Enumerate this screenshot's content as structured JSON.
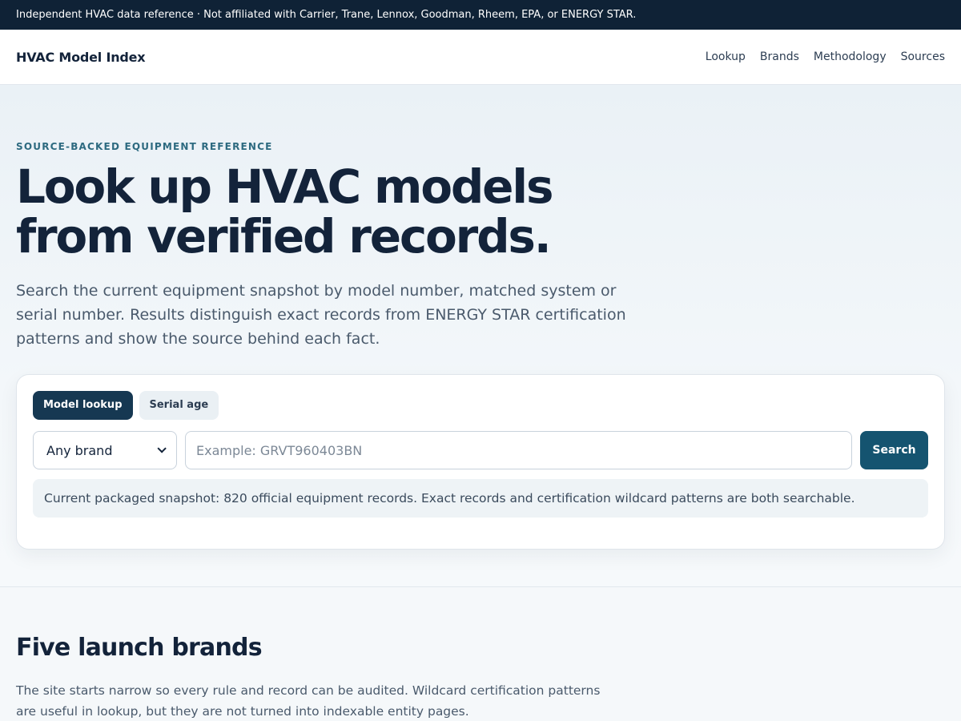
{
  "topbar": {
    "notice": "Independent HVAC data reference · Not affiliated with Carrier, Trane, Lennox, Goodman, Rheem, EPA, or ENERGY STAR."
  },
  "nav": {
    "brand": "HVAC Model Index",
    "links": [
      "Lookup",
      "Brands",
      "Methodology",
      "Sources"
    ]
  },
  "hero": {
    "eyebrow": "SOURCE-BACKED EQUIPMENT REFERENCE",
    "title": "Look up HVAC models from verified records.",
    "lead": "Search the current equipment snapshot by model number, matched system or serial number. Results distinguish exact records from ENERGY STAR certification patterns and show the source behind each fact."
  },
  "search": {
    "tabs": [
      {
        "label": "Model lookup",
        "active": true
      },
      {
        "label": "Serial age",
        "active": false
      }
    ],
    "brand_select": {
      "selected": "Any brand"
    },
    "model_input": {
      "value": "",
      "placeholder": "Example: GRVT960403BN"
    },
    "button_label": "Search",
    "snapshot_note": "Current packaged snapshot: 820 official equipment records. Exact records and certification wildcard patterns are both searchable."
  },
  "brands_section": {
    "title": "Five launch brands",
    "lead": "The site starts narrow so every rule and record can be audited. Wildcard certification patterns are useful in lookup, but they are not turned into indexable entity pages."
  },
  "colors": {
    "topbar_bg": "#0f2236",
    "accent_primary": "#155470",
    "tab_active": "#163852",
    "eyebrow": "#2d6a80"
  }
}
